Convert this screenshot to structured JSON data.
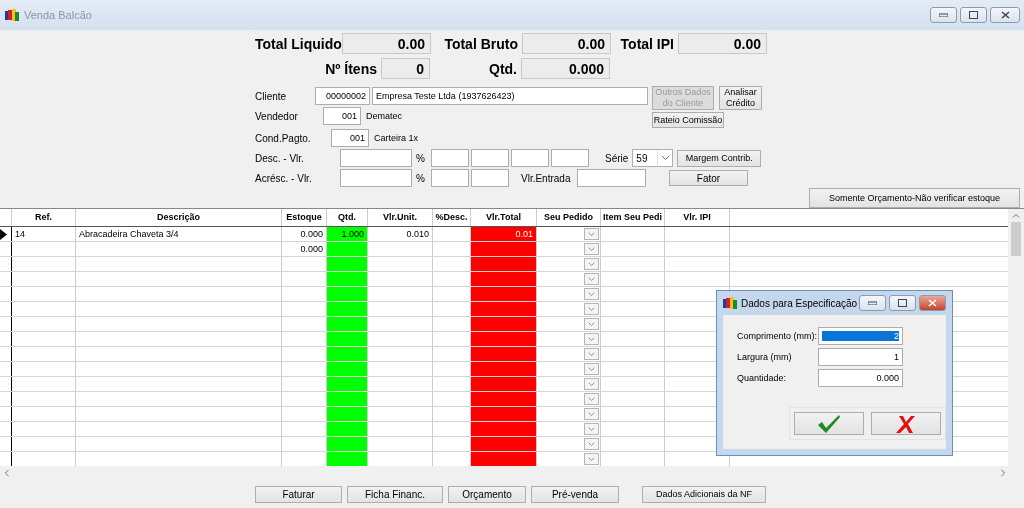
{
  "window": {
    "title": "Venda Balcão"
  },
  "totals": [
    [
      {
        "label": "Total Liquido",
        "value": "0.00"
      },
      {
        "label": "Total Bruto",
        "value": "0.00"
      },
      {
        "label": "Total IPI",
        "value": "0.00"
      }
    ],
    [
      {
        "label": "Nº Ítens",
        "value": "0"
      },
      {
        "label": "Qtd.",
        "value": "0.000"
      }
    ]
  ],
  "cliente": {
    "label": "Cliente",
    "code": "00000002",
    "name": "Empresa Teste Ltda (1937626423)"
  },
  "vendedor": {
    "label": "Vendedor",
    "code": "001",
    "name": "Dematec"
  },
  "cond_pagto": {
    "label": "Cond.Pagto.",
    "code": "001",
    "name": "Carteira 1x"
  },
  "desc": {
    "label": "Desc. - Vlr.",
    "percent": "%"
  },
  "acresc": {
    "label": "Acrésc. - Vlr.",
    "percent": "%"
  },
  "serie": {
    "label": "Série",
    "value": "59"
  },
  "vlr_entrada": {
    "label": "Vlr.Entrada"
  },
  "outros_dados": {
    "label": "Outros Dados\ndo Cliente",
    "disabled": true
  },
  "analisar_credito": {
    "label": "Analisar\nCrédito",
    "disabled": false
  },
  "rateio": {
    "label": "Rateio Comissão"
  },
  "margem": {
    "label": "Margem Contrib."
  },
  "fator": {
    "label": "Fator"
  },
  "somente_orcamento": {
    "label": "Somente Orçamento-Não verificar estoque"
  },
  "grid": {
    "columns": [
      {
        "title": "Ref.",
        "kind": "text"
      },
      {
        "title": "Descrição",
        "kind": "text"
      },
      {
        "title": "Estoque",
        "kind": "text"
      },
      {
        "title": "Qtd.",
        "kind": "text",
        "color": "#00ff00"
      },
      {
        "title": "Vlr.Unit.",
        "kind": "text"
      },
      {
        "title": "%Desc.",
        "kind": "text"
      },
      {
        "title": "Vlr.Total",
        "kind": "text",
        "color": "#ff0000"
      },
      {
        "title": "Seu Pedido",
        "kind": "dropdown"
      },
      {
        "title": "Item Seu Pedi",
        "kind": "text"
      },
      {
        "title": "Vlr. IPI",
        "kind": "text"
      }
    ],
    "rows": [
      {
        "selected": true,
        "ref": "14",
        "descricao": "Abracadeira Chaveta 3/4",
        "estoque": "0.000",
        "qtd": "1.000",
        "vlr_unit": "0.010",
        "vlr_total": "0.01"
      },
      {
        "selected": false,
        "estoque": "0.000"
      }
    ]
  },
  "dialog": {
    "title": "Dados para Especificação",
    "fields": [
      {
        "label": "Comprimento (mm):",
        "value": "2",
        "selected": true
      },
      {
        "label": "Largura (mm)",
        "value": "1",
        "selected": false
      },
      {
        "label": "Quantidade:",
        "value": "0.000",
        "selected": false
      }
    ]
  },
  "footer_buttons": [
    "Faturar",
    "Ficha Financ.",
    "Orçamento",
    "Pré-venda",
    "Dados Adicionais da NF"
  ]
}
